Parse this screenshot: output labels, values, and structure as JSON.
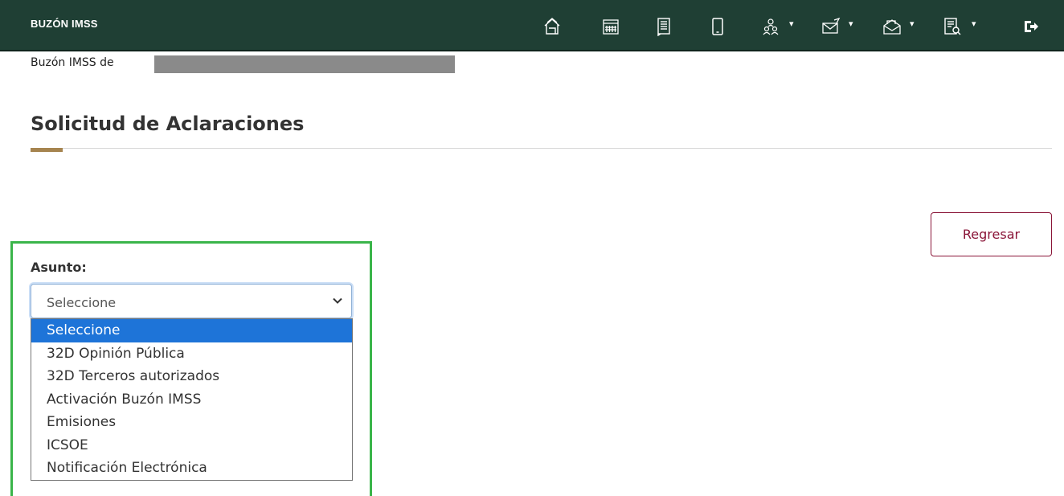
{
  "header": {
    "brand": "BUZÓN IMSS",
    "icons": [
      {
        "name": "home-icon"
      },
      {
        "name": "calendar-icon"
      },
      {
        "name": "document-icon"
      },
      {
        "name": "mobile-icon"
      },
      {
        "name": "users-icon",
        "dropdown": true
      },
      {
        "name": "envelope-icon",
        "dropdown": true
      },
      {
        "name": "open-mail-icon",
        "dropdown": true
      },
      {
        "name": "document-search-icon",
        "dropdown": true
      },
      {
        "name": "logout-icon"
      }
    ],
    "bg_color": "#1f3f34"
  },
  "owner": {
    "label": "Buzón IMSS de"
  },
  "page": {
    "title": "Solicitud de Aclaraciones",
    "accent_color": "#a6844f"
  },
  "actions": {
    "back_label": "Regresar",
    "back_color": "#8a1538"
  },
  "form": {
    "highlight_color": "#3ab54a",
    "subject_label": "Asunto:",
    "subject_value": "Seleccione",
    "options": [
      {
        "label": "Seleccione",
        "selected": true
      },
      {
        "label": "32D Opinión Pública",
        "selected": false
      },
      {
        "label": "32D Terceros autorizados",
        "selected": false
      },
      {
        "label": "Activación Buzón IMSS",
        "selected": false
      },
      {
        "label": "Emisiones",
        "selected": false
      },
      {
        "label": "ICSOE",
        "selected": false
      },
      {
        "label": "Notificación Electrónica",
        "selected": false
      }
    ],
    "selected_color": "#1e74d8"
  }
}
